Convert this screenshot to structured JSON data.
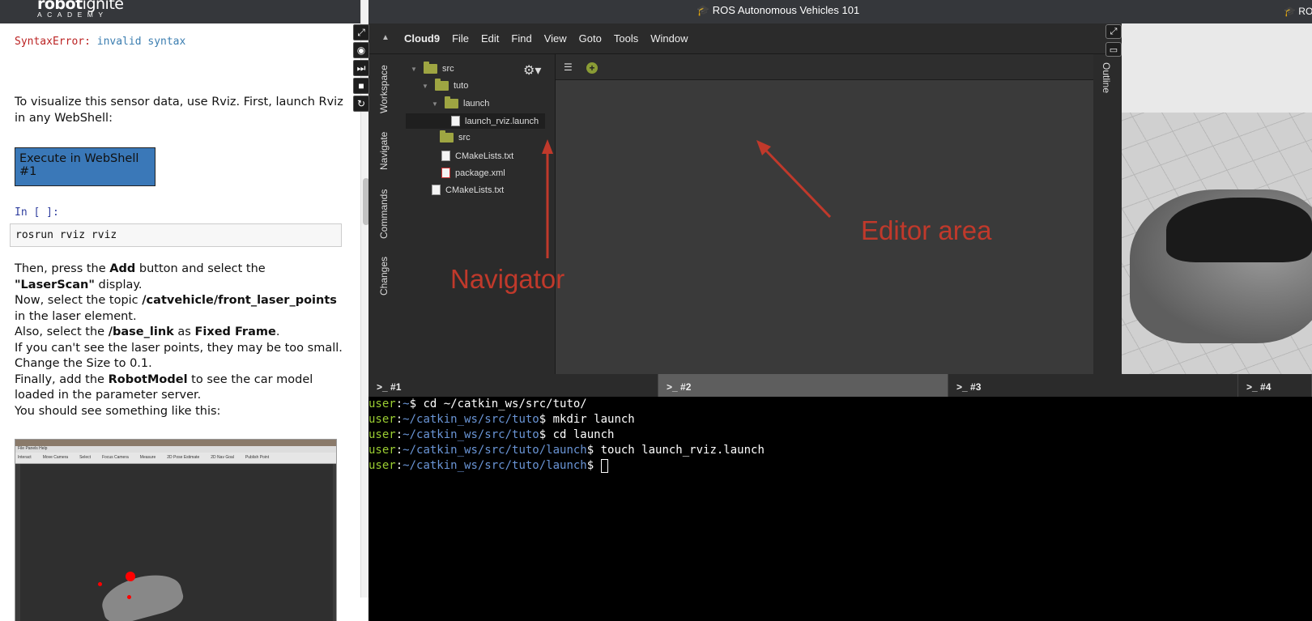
{
  "topbar": {
    "logo_main_bold": "robot",
    "logo_main_thin": "ignite",
    "logo_sub": "ACADEMY",
    "course_title": "🎓 ROS Autonomous Vehicles 101",
    "course_title_clipped": "🎓 RO"
  },
  "notebook": {
    "error_label": "SyntaxError:",
    "error_msg": "invalid syntax",
    "intro": "To visualize this sensor data, use Rviz. First, launch Rviz in any WebShell:",
    "exec_button": "Execute in WebShell #1",
    "in_label": "In [ ]:",
    "code": "rosrun rviz rviz",
    "instr": {
      "l1a": "Then, press the ",
      "l1b": "Add",
      "l1c": " button and select the ",
      "l1d": "\"LaserScan\"",
      "l1e": " display.",
      "l2a": "Now, select the topic ",
      "l2b": "/catvehicle/front_laser_points",
      "l2c": " in the laser element.",
      "l3a": "Also, select the ",
      "l3b": "/base_link",
      "l3c": " as ",
      "l3d": "Fixed Frame",
      "l3e": ".",
      "l4": "If you can't see the laser points, they may be too small. Change the Size to 0.1.",
      "l5a": "Finally, add the ",
      "l5b": "RobotModel",
      "l5c": " to see the car model loaded in the parameter server.",
      "l6": "You should see something like this:"
    },
    "rviz": {
      "menu": "File  Panels  Help",
      "tools": [
        "Interact",
        "Move Camera",
        "Select",
        "Focus Camera",
        "Measure",
        "2D Pose Estimate",
        "2D Nav Goal",
        "Publish Point"
      ]
    }
  },
  "ide": {
    "menu": [
      "Cloud9",
      "File",
      "Edit",
      "Find",
      "View",
      "Goto",
      "Tools",
      "Window"
    ],
    "side_tabs": [
      "Workspace",
      "Navigate",
      "Commands",
      "Changes"
    ],
    "outline_tab": "Outline",
    "tree": [
      {
        "label": "src"
      },
      {
        "label": "tuto"
      },
      {
        "label": "launch"
      },
      {
        "label": "launch_rviz.launch"
      },
      {
        "label": "src"
      },
      {
        "label": "CMakeLists.txt"
      },
      {
        "label": "package.xml"
      },
      {
        "label": "CMakeLists.txt"
      }
    ]
  },
  "annotations": {
    "navigator": "Navigator",
    "editor": "Editor area",
    "color": "#c0392b"
  },
  "terminal": {
    "tabs": [
      ">_ #1",
      ">_ #2",
      ">_ #3",
      ">_ #4"
    ],
    "active_tab": 1,
    "lines": [
      {
        "user": "user",
        "path": "~",
        "cmd": "$ cd ~/catkin_ws/src/tuto/"
      },
      {
        "user": "user",
        "path": "~/catkin_ws/src/tuto",
        "cmd": "$ mkdir launch"
      },
      {
        "user": "user",
        "path": "~/catkin_ws/src/tuto",
        "cmd": "$ cd launch"
      },
      {
        "user": "user",
        "path": "~/catkin_ws/src/tuto/launch",
        "cmd": "$ touch launch_rviz.launch"
      },
      {
        "user": "user",
        "path": "~/catkin_ws/src/tuto/launch",
        "cmd": "$ "
      }
    ]
  }
}
